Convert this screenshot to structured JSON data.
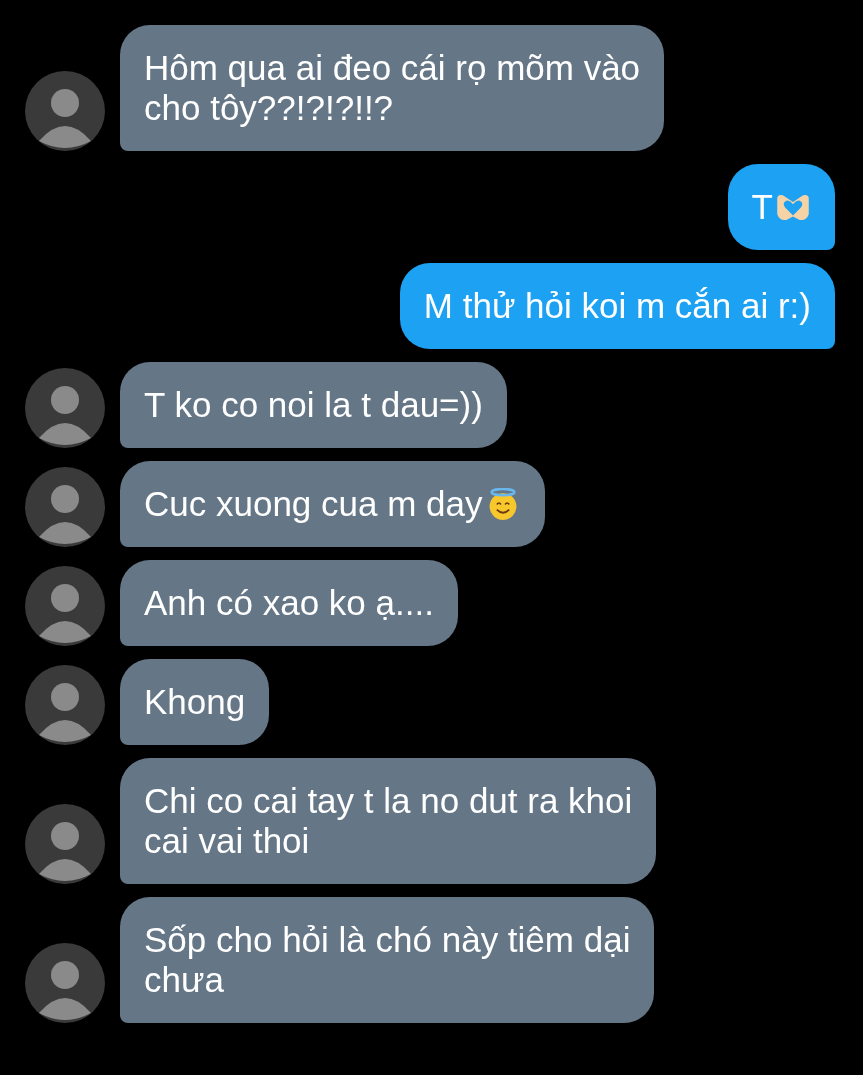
{
  "messages": [
    {
      "kind": "incoming",
      "text": "Hôm qua ai đeo cái rọ mõm vào\ncho tôy??!?!?!!?"
    },
    {
      "kind": "outgoing",
      "text": "T",
      "icons": [
        {
          "kind": "heart"
        }
      ]
    },
    {
      "kind": "outgoing",
      "text": "M thử hỏi koi m cắn ai r:)"
    },
    {
      "kind": "incoming",
      "text": "T ko co noi la t dau=))"
    },
    {
      "kind": "incoming",
      "text": "Cuc xuong cua m day",
      "icons": [
        {
          "kind": "halo"
        }
      ]
    },
    {
      "kind": "incoming",
      "text": "Anh có xao ko ạ...."
    },
    {
      "kind": "incoming",
      "text": "Khong"
    },
    {
      "kind": "incoming",
      "text": "Chi co cai tay t la no dut ra khoi\ncai vai thoi"
    },
    {
      "kind": "incoming",
      "text": "Sốp cho hỏi là chó này tiêm dại\nchưa"
    }
  ]
}
